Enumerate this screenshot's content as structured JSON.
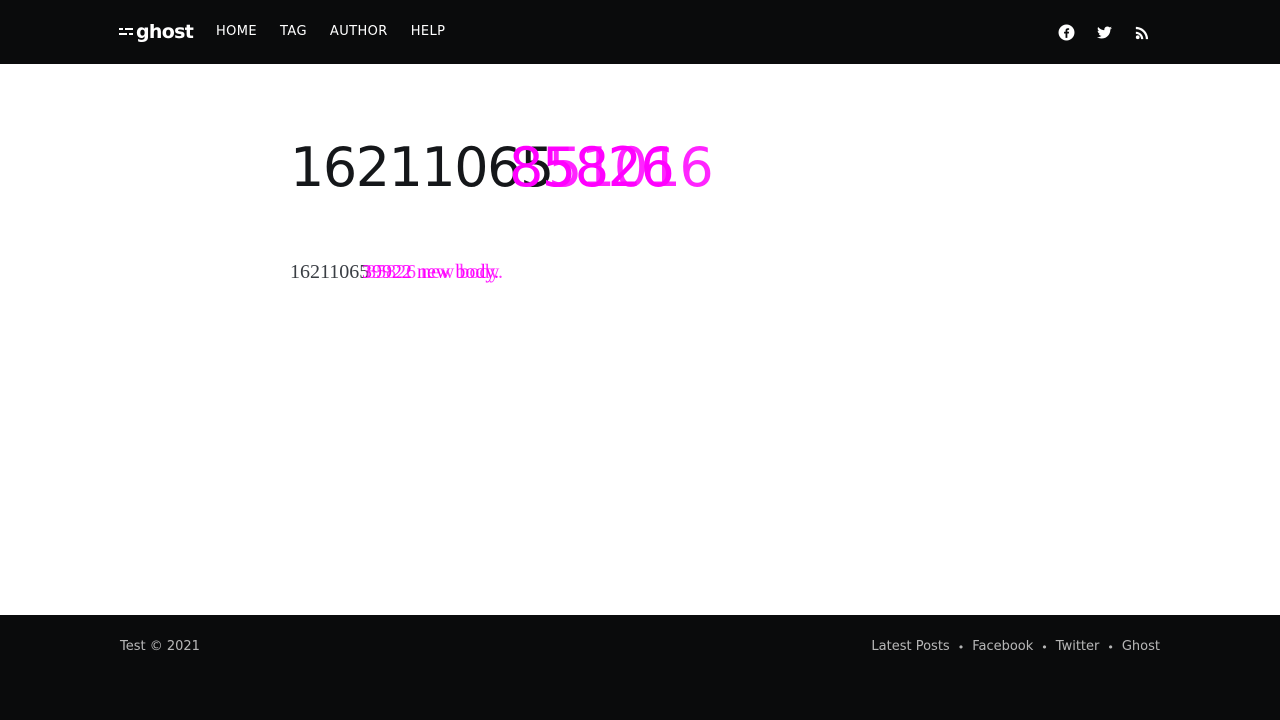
{
  "header": {
    "logo_text": "ghost",
    "nav": [
      {
        "label": "HOME"
      },
      {
        "label": "TAG"
      },
      {
        "label": "AUTHOR"
      },
      {
        "label": "HELP"
      }
    ],
    "social_icons": [
      "facebook-icon",
      "twitter-icon",
      "rss-icon"
    ]
  },
  "post": {
    "title_base": "16211065",
    "title_overlay": "85826",
    "title_overlay2": "51016",
    "body_base": "16211065",
    "body_overlay": "39922 new body.",
    "body_overlay2": "85826 new body."
  },
  "footer": {
    "copyright": "Test © 2021",
    "links": [
      {
        "label": "Latest Posts"
      },
      {
        "label": "Facebook"
      },
      {
        "label": "Twitter"
      },
      {
        "label": "Ghost"
      }
    ]
  },
  "colors": {
    "header_bg": "#0a0b0c",
    "overlay_text": "#ff00ff",
    "title_text": "#15171a"
  }
}
